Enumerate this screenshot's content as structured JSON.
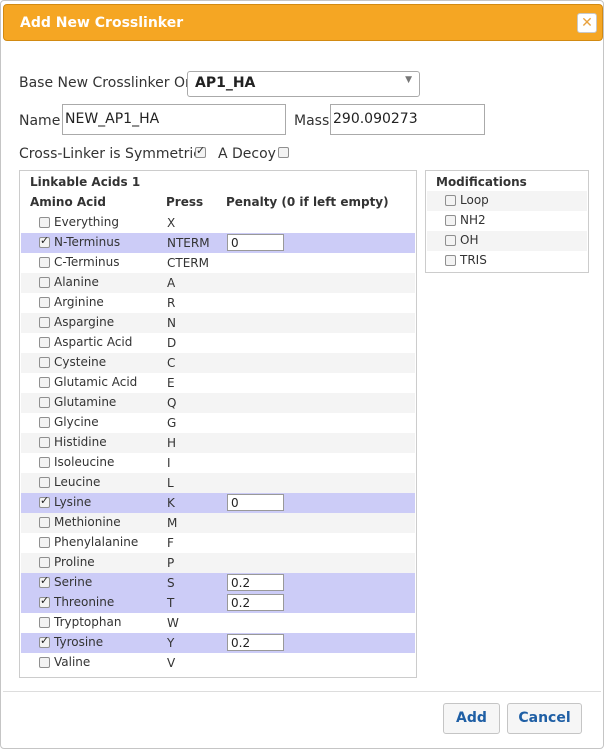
{
  "dialog": {
    "title": "Add New Crosslinker",
    "close_symbol": "✕"
  },
  "form": {
    "base_label": "Base New Crosslinker On",
    "base_value": "AP1_HA",
    "name_label": "Name",
    "name_value": "NEW_AP1_HA",
    "mass_label": "Mass",
    "mass_value": "290.090273",
    "symmetric_label": "Cross-Linker is Symmetric",
    "symmetric_checked": true,
    "decoy_label": "A Decoy",
    "decoy_checked": false
  },
  "acids": {
    "title": "Linkable Acids 1",
    "columns": [
      "Amino Acid",
      "Press",
      "Penalty (0 if left empty)"
    ],
    "rows": [
      {
        "name": "Everything",
        "press": "X",
        "checked": false,
        "penalty": null
      },
      {
        "name": "N-Terminus",
        "press": "NTERM",
        "checked": true,
        "penalty": "0"
      },
      {
        "name": "C-Terminus",
        "press": "CTERM",
        "checked": false,
        "penalty": null
      },
      {
        "name": "Alanine",
        "press": "A",
        "checked": false,
        "penalty": null
      },
      {
        "name": "Arginine",
        "press": "R",
        "checked": false,
        "penalty": null
      },
      {
        "name": "Aspargine",
        "press": "N",
        "checked": false,
        "penalty": null
      },
      {
        "name": "Aspartic Acid",
        "press": "D",
        "checked": false,
        "penalty": null
      },
      {
        "name": "Cysteine",
        "press": "C",
        "checked": false,
        "penalty": null
      },
      {
        "name": "Glutamic Acid",
        "press": "E",
        "checked": false,
        "penalty": null
      },
      {
        "name": "Glutamine",
        "press": "Q",
        "checked": false,
        "penalty": null
      },
      {
        "name": "Glycine",
        "press": "G",
        "checked": false,
        "penalty": null
      },
      {
        "name": "Histidine",
        "press": "H",
        "checked": false,
        "penalty": null
      },
      {
        "name": "Isoleucine",
        "press": "I",
        "checked": false,
        "penalty": null
      },
      {
        "name": "Leucine",
        "press": "L",
        "checked": false,
        "penalty": null
      },
      {
        "name": "Lysine",
        "press": "K",
        "checked": true,
        "penalty": "0"
      },
      {
        "name": "Methionine",
        "press": "M",
        "checked": false,
        "penalty": null
      },
      {
        "name": "Phenylalanine",
        "press": "F",
        "checked": false,
        "penalty": null
      },
      {
        "name": "Proline",
        "press": "P",
        "checked": false,
        "penalty": null
      },
      {
        "name": "Serine",
        "press": "S",
        "checked": true,
        "penalty": "0.2"
      },
      {
        "name": "Threonine",
        "press": "T",
        "checked": true,
        "penalty": "0.2"
      },
      {
        "name": "Tryptophan",
        "press": "W",
        "checked": false,
        "penalty": null
      },
      {
        "name": "Tyrosine",
        "press": "Y",
        "checked": true,
        "penalty": "0.2"
      },
      {
        "name": "Valine",
        "press": "V",
        "checked": false,
        "penalty": null
      }
    ]
  },
  "modifications": {
    "title": "Modifications",
    "items": [
      {
        "name": "Loop",
        "checked": false
      },
      {
        "name": "NH2",
        "checked": false
      },
      {
        "name": "OH",
        "checked": false
      },
      {
        "name": "TRIS",
        "checked": false
      }
    ]
  },
  "footer": {
    "add_label": "Add",
    "cancel_label": "Cancel"
  },
  "colors": {
    "titlebar": "#f5a623",
    "selected_row": "#ccccf7",
    "button_text": "#1f5fa5"
  }
}
